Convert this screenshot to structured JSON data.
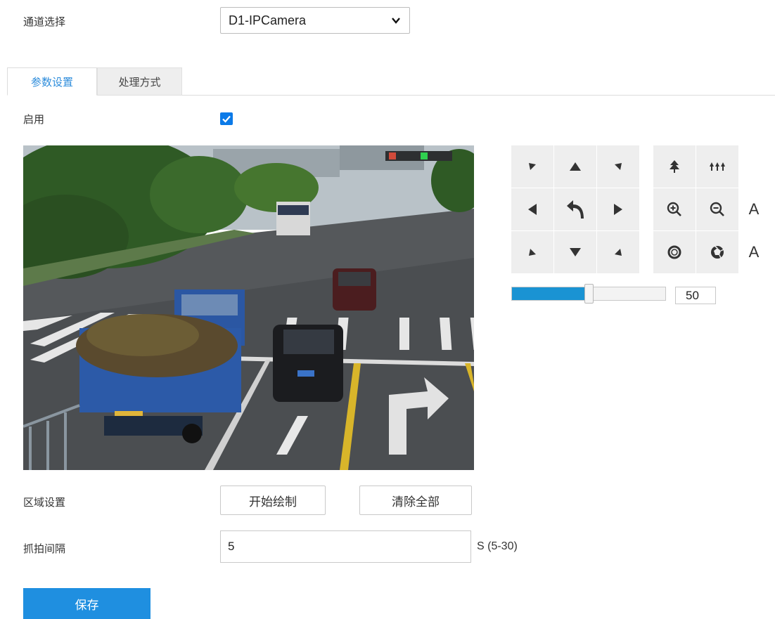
{
  "channel": {
    "label": "通道选择",
    "selected": "D1-IPCamera"
  },
  "tabs": [
    {
      "label": "参数设置",
      "active": true
    },
    {
      "label": "处理方式",
      "active": false
    }
  ],
  "enable": {
    "label": "启用",
    "checked": true
  },
  "ptz": {
    "zoom_label_in": "A",
    "zoom_label_out": "A",
    "speed": {
      "value": 50,
      "display": "50",
      "max": 100
    }
  },
  "region": {
    "label": "区域设置",
    "start_draw": "开始绘制",
    "clear_all": "清除全部"
  },
  "interval": {
    "label": "抓拍间隔",
    "value": "5",
    "unit_hint": "S (5-30)"
  },
  "save_label": "保存",
  "colors": {
    "accent": "#1f8fe0",
    "slider": "#1a93d3",
    "checkbox": "#0b7ae8",
    "tab_active": "#2d8cdb"
  }
}
